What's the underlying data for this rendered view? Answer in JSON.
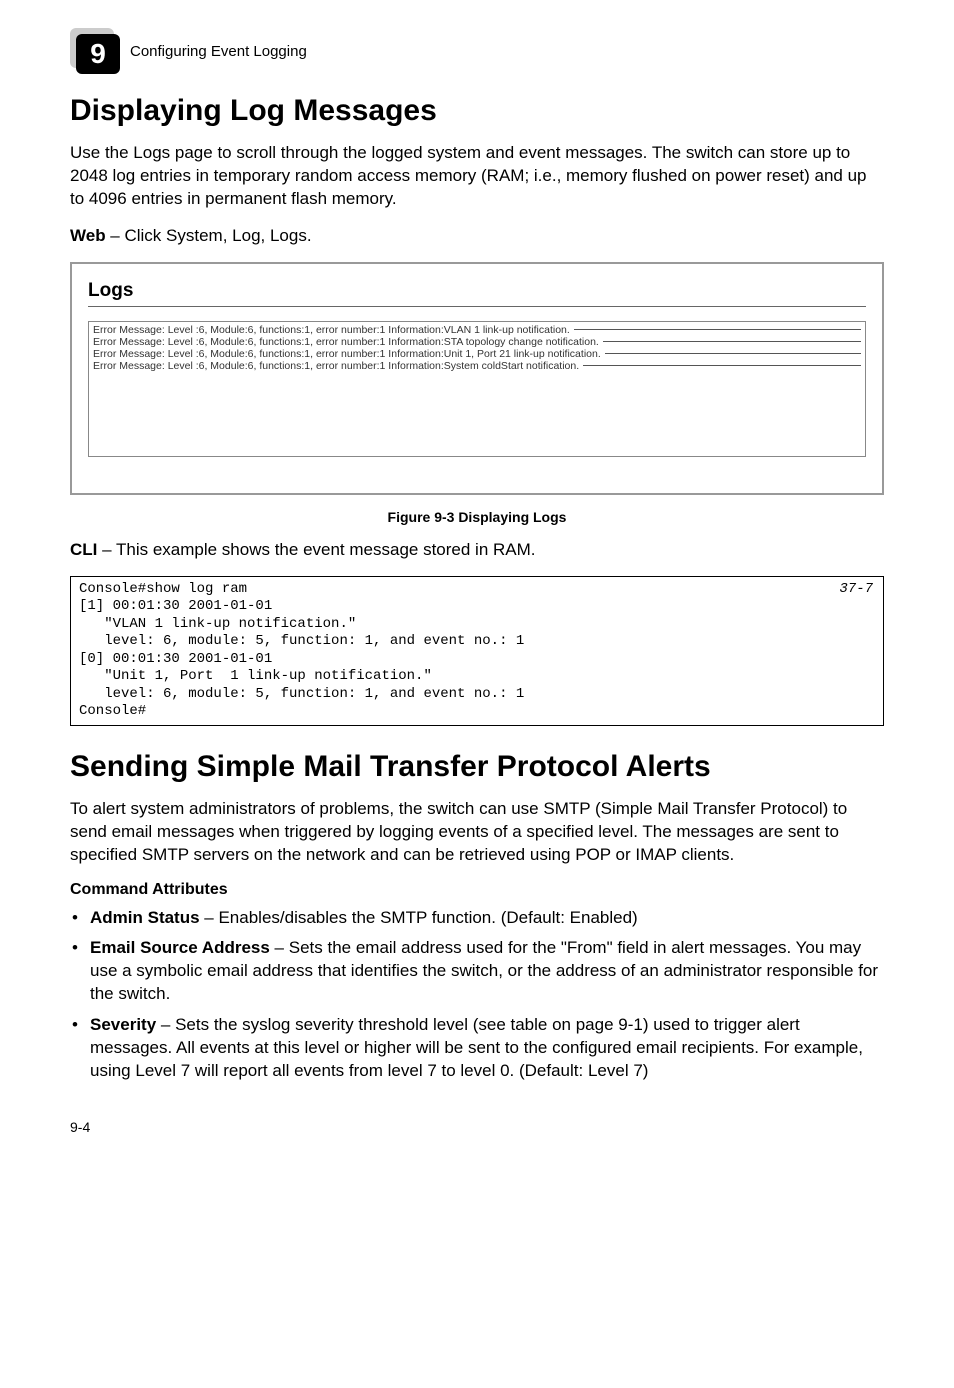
{
  "header": {
    "chapter_number": "9",
    "chapter_label": "Configuring Event Logging"
  },
  "section1": {
    "title": "Displaying Log Messages",
    "para1": "Use the Logs page to scroll through the logged system and event messages. The switch can store up to 2048 log entries in temporary random access memory (RAM; i.e., memory flushed on power reset) and up to 4096 entries in permanent flash memory.",
    "web_lead": "Web",
    "web_rest": " – Click System, Log, Logs."
  },
  "screenshot": {
    "title": "Logs",
    "lines": [
      "Error Message: Level :6, Module:6, functions:1, error number:1 Information:VLAN 1 link-up notification.",
      "Error Message: Level :6, Module:6, functions:1, error number:1 Information:STA topology change notification.",
      "Error Message: Level :6, Module:6, functions:1, error number:1 Information:Unit 1, Port 21 link-up notification.",
      "Error Message: Level :6, Module:6, functions:1, error number:1 Information:System coldStart notification."
    ]
  },
  "figure_caption": "Figure 9-3  Displaying Logs",
  "cli": {
    "lead": "CLI",
    "rest": " – This example shows the event message stored in RAM."
  },
  "code": {
    "page_ref": "37-7",
    "lines": [
      "Console#show log ram",
      "[1] 00:01:30 2001-01-01",
      "   \"VLAN 1 link-up notification.\"",
      "   level: 6, module: 5, function: 1, and event no.: 1",
      "[0] 00:01:30 2001-01-01",
      "   \"Unit 1, Port  1 link-up notification.\"",
      "   level: 6, module: 5, function: 1, and event no.: 1",
      "Console#"
    ]
  },
  "section2": {
    "title": "Sending Simple Mail Transfer Protocol Alerts",
    "para1": "To alert system administrators of problems, the switch can use SMTP (Simple Mail Transfer Protocol) to send email messages when triggered by logging events of a specified level. The messages are sent to specified SMTP servers on the network and can be retrieved using POP or IMAP clients.",
    "cmd_attr_heading": "Command Attributes",
    "bullets": [
      {
        "lead": "Admin Status",
        "rest": " – Enables/disables the SMTP function. (Default: Enabled)"
      },
      {
        "lead": "Email Source Address",
        "rest": " – Sets the email address used for the \"From\" field in alert messages. You may use a symbolic email address that identifies the switch, or the address of an administrator responsible for the switch."
      },
      {
        "lead": "Severity",
        "rest": " – Sets the syslog severity threshold level (see table on page 9-1) used to trigger alert messages. All events at this level or higher will be sent to the configured email recipients. For example, using Level 7 will report all events from level 7 to level 0. (Default: Level 7)"
      }
    ]
  },
  "footer_page": "9-4"
}
